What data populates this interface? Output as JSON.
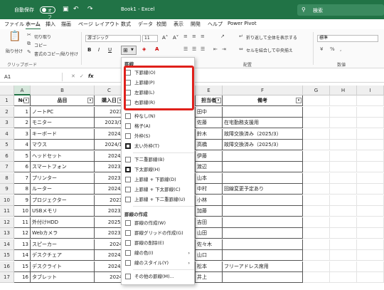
{
  "titlebar": {
    "autosave_label": "自動保存",
    "autosave_state": "オフ",
    "book_title": "Book1 - Excel",
    "search_placeholder": "検索"
  },
  "menu": [
    "ファイル",
    "ホーム",
    "挿入",
    "描画",
    "ページ レイアウト",
    "数式",
    "データ",
    "校閲",
    "表示",
    "開発",
    "ヘルプ",
    "Power Pivot"
  ],
  "ribbon": {
    "paste": "貼り付け",
    "cut": "切り取り",
    "copy": "コピー",
    "format_painter": "書式のコピー/貼り付け",
    "clipboard_group": "クリップボード",
    "font_name": "游ゴシック",
    "font_size": "11",
    "wrap_text": "折り返して全体を表示する",
    "merge_center": "セルを結合して中央揃え",
    "alignment_group": "配置",
    "number_format": "標準",
    "number_group": "数値",
    "borders_group": "罫線"
  },
  "namebox": "A1",
  "fx": "fx",
  "columns": [
    "A",
    "B",
    "C",
    "D",
    "E",
    "F",
    "G",
    "H",
    "I"
  ],
  "table": {
    "headers": [
      "No",
      "品目",
      "購入日",
      "",
      "担当者",
      "備考"
    ],
    "rows": [
      {
        "no": "1",
        "item": "ノートPC",
        "date": "2023",
        "person": "田中",
        "note": ""
      },
      {
        "no": "2",
        "item": "モニター",
        "date": "2023/1",
        "person": "佐藤",
        "note": "在宅勤務支援用"
      },
      {
        "no": "3",
        "item": "キーボード",
        "date": "2024/",
        "person": "鈴木",
        "note": "故障交換済み（2025/3）"
      },
      {
        "no": "4",
        "item": "マウス",
        "date": "2024/1",
        "person": "高橋",
        "note": "故障交換済み（2025/3）"
      },
      {
        "no": "5",
        "item": "ヘッドセット",
        "date": "2024/",
        "person": "伊藤",
        "note": ""
      },
      {
        "no": "6",
        "item": "スマートフォン",
        "date": "2023/",
        "person": "渡辺",
        "note": ""
      },
      {
        "no": "7",
        "item": "プリンター",
        "date": "2023/",
        "person": "山本",
        "note": ""
      },
      {
        "no": "8",
        "item": "ルーター",
        "date": "2024/",
        "person": "中村",
        "note": "回線変更予定あり"
      },
      {
        "no": "9",
        "item": "プロジェクター",
        "date": "2023",
        "person": "小林",
        "note": ""
      },
      {
        "no": "10",
        "item": "USBメモリ",
        "date": "2023/",
        "person": "加藤",
        "note": ""
      },
      {
        "no": "11",
        "item": "外付けHDD",
        "date": "2025/",
        "person": "吉田",
        "note": ""
      },
      {
        "no": "12",
        "item": "Webカメラ",
        "date": "2023/",
        "person": "山田",
        "note": ""
      },
      {
        "no": "13",
        "item": "スピーカー",
        "date": "2024",
        "person": "佐々木",
        "note": ""
      },
      {
        "no": "14",
        "item": "デスクチェア",
        "date": "2024/",
        "person": "山口",
        "note": ""
      },
      {
        "no": "15",
        "item": "デスクライト",
        "date": "2024/",
        "person": "松本",
        "note": "フリーアドレス席用"
      },
      {
        "no": "16",
        "item": "タブレット",
        "date": "2024",
        "person": "井上",
        "note": ""
      }
    ]
  },
  "row_numbers": [
    "1",
    "2",
    "3",
    "4",
    "5",
    "6",
    "7",
    "8",
    "9",
    "10",
    "11",
    "12",
    "13",
    "14",
    "15",
    "16",
    "17"
  ],
  "border_menu": {
    "title": "罫線",
    "items": [
      {
        "label": "下罫線(O)",
        "arrow": ""
      },
      {
        "label": "上罫線(P)",
        "arrow": ""
      },
      {
        "label": "左罫線(L)",
        "arrow": ""
      },
      {
        "label": "右罫線(R)",
        "arrow": ""
      },
      {
        "label": "枠なし(N)",
        "arrow": ""
      },
      {
        "label": "格子(A)",
        "arrow": ""
      },
      {
        "label": "外枠(S)",
        "arrow": ""
      },
      {
        "label": "太い外枠(T)",
        "arrow": ""
      },
      {
        "label": "下二重罫線(B)",
        "arrow": ""
      },
      {
        "label": "下太罫線(H)",
        "arrow": ""
      },
      {
        "label": "上罫線 + 下罫線(D)",
        "arrow": ""
      },
      {
        "label": "上罫線 + 下太罫線(C)",
        "arrow": ""
      },
      {
        "label": "上罫線 + 下二重罫線(U)",
        "arrow": ""
      }
    ],
    "draw_heading": "罫線の作成",
    "draw_items": [
      {
        "label": "罫線の作成(W)",
        "arrow": ""
      },
      {
        "label": "罫線グリッドの作成(G)",
        "arrow": ""
      },
      {
        "label": "罫線の削除(E)",
        "arrow": ""
      },
      {
        "label": "線の色(I)",
        "arrow": "›"
      },
      {
        "label": "線のスタイル(Y)",
        "arrow": "›"
      },
      {
        "label": "その他の罫線(M)...",
        "arrow": ""
      }
    ]
  },
  "colors": {
    "brand": "#217346",
    "highlight": "#e0201b"
  }
}
